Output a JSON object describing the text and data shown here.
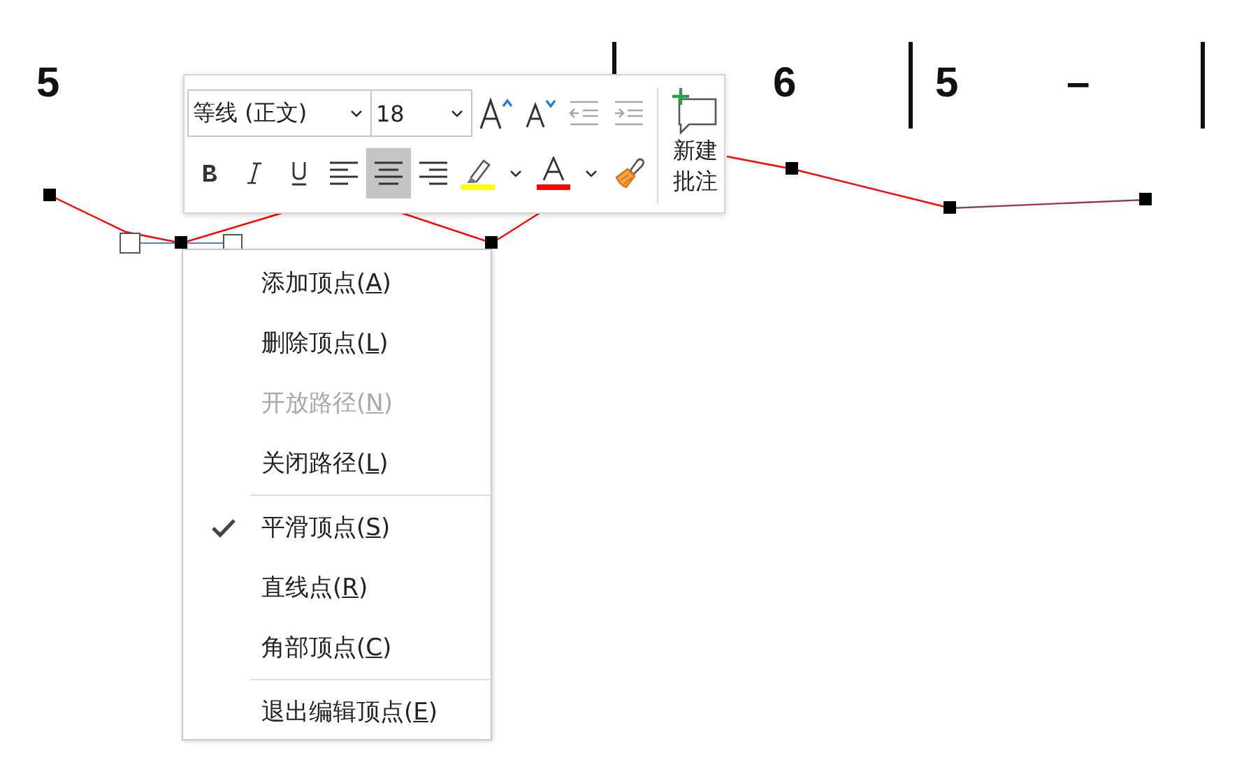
{
  "score": {
    "items": [
      {
        "kind": "note",
        "text": "5"
      },
      {
        "kind": "bar"
      },
      {
        "kind": "note",
        "text": "6"
      },
      {
        "kind": "bar"
      },
      {
        "kind": "note",
        "text": "5"
      },
      {
        "kind": "note",
        "text": "–"
      },
      {
        "kind": "bar"
      }
    ]
  },
  "mini_toolbar": {
    "font_name": "等线 (正文)",
    "font_size": "18",
    "row_1": [
      {
        "kind": "grow-font"
      },
      {
        "kind": "shrink-font"
      },
      {
        "kind": "outdent",
        "disabled": true
      },
      {
        "kind": "indent",
        "disabled": true
      }
    ],
    "row_2": [
      {
        "kind": "bold",
        "selected": false
      },
      {
        "kind": "italic",
        "selected": false
      },
      {
        "kind": "underline",
        "selected": false
      },
      {
        "kind": "align-left",
        "selected": false
      },
      {
        "kind": "align-center",
        "selected": true
      },
      {
        "kind": "align-right",
        "selected": false
      },
      {
        "kind": "highlight",
        "color": "#ffff00"
      },
      {
        "kind": "font-color",
        "color": "#ff0000"
      },
      {
        "kind": "painter"
      }
    ],
    "comment_button": "新建批注"
  },
  "context_menu": {
    "items": [
      {
        "kind": "item",
        "label": "添加顶点(A)",
        "disabled": false,
        "checked": false
      },
      {
        "kind": "item",
        "label": "删除顶点(L)",
        "disabled": false,
        "checked": false
      },
      {
        "kind": "item",
        "label": "开放路径(N)",
        "disabled": true,
        "checked": false
      },
      {
        "kind": "item",
        "label": "关闭路径(L)",
        "disabled": false,
        "checked": false
      },
      {
        "kind": "separator"
      },
      {
        "kind": "item",
        "label": "平滑顶点(S)",
        "disabled": false,
        "checked": true
      },
      {
        "kind": "item",
        "label": "直线点(R)",
        "disabled": false,
        "checked": false
      },
      {
        "kind": "item",
        "label": "角部顶点(C)",
        "disabled": false,
        "checked": false
      },
      {
        "kind": "separator"
      },
      {
        "kind": "item",
        "label": "退出编辑顶点(E)",
        "disabled": false,
        "checked": false
      }
    ]
  }
}
